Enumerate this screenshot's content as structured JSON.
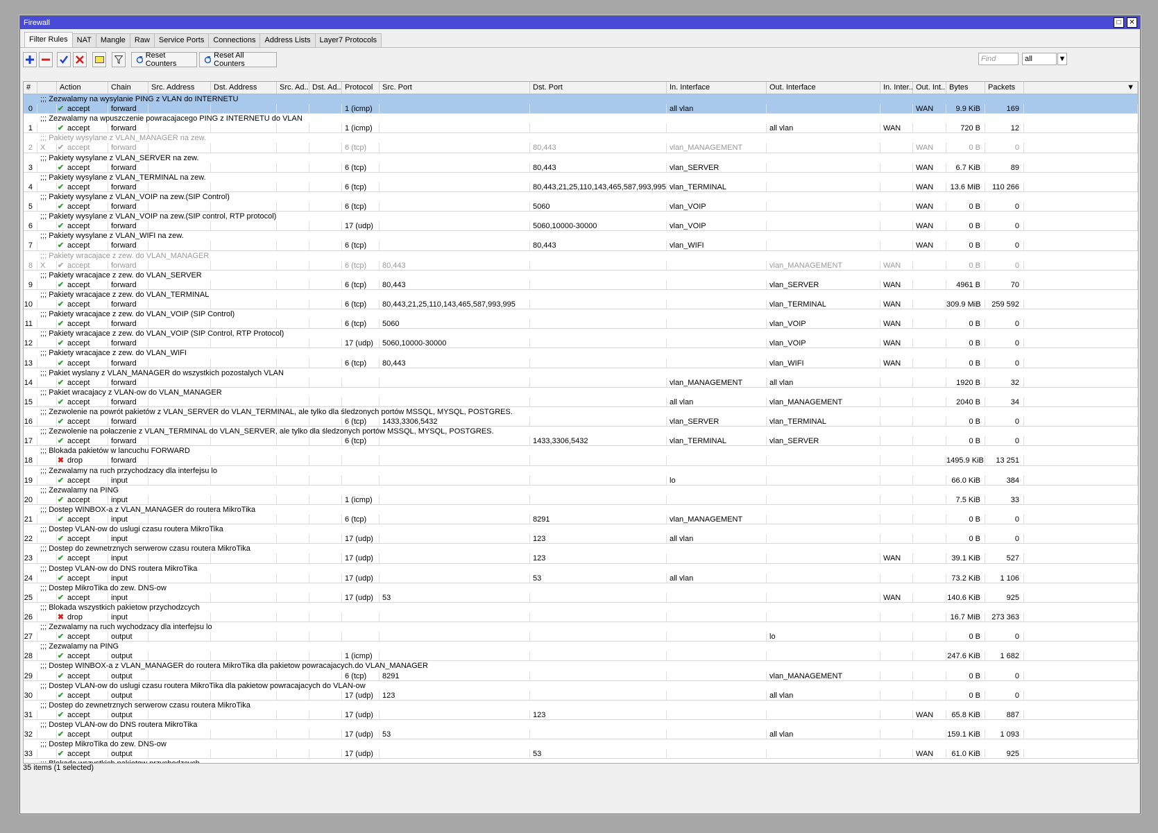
{
  "window": {
    "title": "Firewall"
  },
  "tabs": [
    "Filter Rules",
    "NAT",
    "Mangle",
    "Raw",
    "Service Ports",
    "Connections",
    "Address Lists",
    "Layer7 Protocols"
  ],
  "toolbar": {
    "reset_counters": "Reset Counters",
    "reset_all_counters": "Reset All Counters",
    "find_placeholder": "Find",
    "filter_value": "all"
  },
  "columns": [
    "#",
    "Action",
    "Chain",
    "Src. Address",
    "Dst. Address",
    "Src. Ad...",
    "Dst. Ad...",
    "Protocol",
    "Src. Port",
    "Dst. Port",
    "In. Interface",
    "Out. Interface",
    "In. Inter...",
    "Out. Int...",
    "Bytes",
    "Packets"
  ],
  "status": "35 items (1 selected)",
  "rows": [
    {
      "type": "comment",
      "text": ";;; Zezwalamy na wysylanie PING z VLAN do INTERNETU",
      "selected": true
    },
    {
      "type": "rule",
      "num": "0",
      "x": "",
      "action": "accept",
      "chain": "forward",
      "proto": "1 (icmp)",
      "sport": "",
      "dport": "",
      "inif": "all vlan",
      "outif": "",
      "inlist": "",
      "outlist": "WAN",
      "bytes": "9.9 KiB",
      "packets": "169",
      "selected": true
    },
    {
      "type": "comment",
      "text": ";;; Zezwalamy na wpuszczenie powracajacego PING z INTERNETU do VLAN"
    },
    {
      "type": "rule",
      "num": "1",
      "x": "",
      "action": "accept",
      "chain": "forward",
      "proto": "1 (icmp)",
      "sport": "",
      "dport": "",
      "inif": "",
      "outif": "all vlan",
      "inlist": "WAN",
      "outlist": "",
      "bytes": "720 B",
      "packets": "12"
    },
    {
      "type": "comment",
      "text": ";;; Pakiety wysylane z VLAN_MANAGER na zew.",
      "disabled": true
    },
    {
      "type": "rule",
      "num": "2",
      "x": "X",
      "action": "accept",
      "chain": "forward",
      "proto": "6 (tcp)",
      "sport": "",
      "dport": "80,443",
      "inif": "vlan_MANAGEMENT",
      "outif": "",
      "inlist": "",
      "outlist": "WAN",
      "bytes": "0 B",
      "packets": "0",
      "disabled": true
    },
    {
      "type": "comment",
      "text": ";;; Pakiety wysylane z VLAN_SERVER na zew."
    },
    {
      "type": "rule",
      "num": "3",
      "x": "",
      "action": "accept",
      "chain": "forward",
      "proto": "6 (tcp)",
      "sport": "",
      "dport": "80,443",
      "inif": "vlan_SERVER",
      "outif": "",
      "inlist": "",
      "outlist": "WAN",
      "bytes": "6.7 KiB",
      "packets": "89"
    },
    {
      "type": "comment",
      "text": ";;; Pakiety wysylane z VLAN_TERMINAL na zew."
    },
    {
      "type": "rule",
      "num": "4",
      "x": "",
      "action": "accept",
      "chain": "forward",
      "proto": "6 (tcp)",
      "sport": "",
      "dport": "80,443,21,25,110,143,465,587,993,995",
      "inif": "vlan_TERMINAL",
      "outif": "",
      "inlist": "",
      "outlist": "WAN",
      "bytes": "13.6 MiB",
      "packets": "110 266"
    },
    {
      "type": "comment",
      "text": ";;; Pakiety wysylane z VLAN_VOIP na zew.(SIP Control)"
    },
    {
      "type": "rule",
      "num": "5",
      "x": "",
      "action": "accept",
      "chain": "forward",
      "proto": "6 (tcp)",
      "sport": "",
      "dport": "5060",
      "inif": "vlan_VOIP",
      "outif": "",
      "inlist": "",
      "outlist": "WAN",
      "bytes": "0 B",
      "packets": "0"
    },
    {
      "type": "comment",
      "text": ";;; Pakiety wysylane z VLAN_VOIP na zew.(SIP control, RTP protocol)"
    },
    {
      "type": "rule",
      "num": "6",
      "x": "",
      "action": "accept",
      "chain": "forward",
      "proto": "17 (udp)",
      "sport": "",
      "dport": "5060,10000-30000",
      "inif": "vlan_VOIP",
      "outif": "",
      "inlist": "",
      "outlist": "WAN",
      "bytes": "0 B",
      "packets": "0"
    },
    {
      "type": "comment",
      "text": ";;; Pakiety wysylane z VLAN_WIFI na zew."
    },
    {
      "type": "rule",
      "num": "7",
      "x": "",
      "action": "accept",
      "chain": "forward",
      "proto": "6 (tcp)",
      "sport": "",
      "dport": "80,443",
      "inif": "vlan_WIFI",
      "outif": "",
      "inlist": "",
      "outlist": "WAN",
      "bytes": "0 B",
      "packets": "0"
    },
    {
      "type": "comment",
      "text": ";;; Pakiety wracajace z zew. do VLAN_MANAGER",
      "disabled": true
    },
    {
      "type": "rule",
      "num": "8",
      "x": "X",
      "action": "accept",
      "chain": "forward",
      "proto": "6 (tcp)",
      "sport": "80,443",
      "dport": "",
      "inif": "",
      "outif": "vlan_MANAGEMENT",
      "inlist": "WAN",
      "outlist": "",
      "bytes": "0 B",
      "packets": "0",
      "disabled": true
    },
    {
      "type": "comment",
      "text": ";;; Pakiety wracajace z zew. do VLAN_SERVER"
    },
    {
      "type": "rule",
      "num": "9",
      "x": "",
      "action": "accept",
      "chain": "forward",
      "proto": "6 (tcp)",
      "sport": "80,443",
      "dport": "",
      "inif": "",
      "outif": "vlan_SERVER",
      "inlist": "WAN",
      "outlist": "",
      "bytes": "4961 B",
      "packets": "70"
    },
    {
      "type": "comment",
      "text": ";;; Pakiety wracajace z zew. do VLAN_TERMINAL"
    },
    {
      "type": "rule",
      "num": "10",
      "x": "",
      "action": "accept",
      "chain": "forward",
      "proto": "6 (tcp)",
      "sport": "80,443,21,25,110,143,465,587,993,995",
      "dport": "",
      "inif": "",
      "outif": "vlan_TERMINAL",
      "inlist": "WAN",
      "outlist": "",
      "bytes": "309.9 MiB",
      "packets": "259 592"
    },
    {
      "type": "comment",
      "text": ";;; Pakiety wracajace z zew. do VLAN_VOIP (SIP Control)"
    },
    {
      "type": "rule",
      "num": "11",
      "x": "",
      "action": "accept",
      "chain": "forward",
      "proto": "6 (tcp)",
      "sport": "5060",
      "dport": "",
      "inif": "",
      "outif": "vlan_VOIP",
      "inlist": "WAN",
      "outlist": "",
      "bytes": "0 B",
      "packets": "0"
    },
    {
      "type": "comment",
      "text": ";;; Pakiety wracajace z zew. do VLAN_VOIP (SIP Control, RTP Protocol)"
    },
    {
      "type": "rule",
      "num": "12",
      "x": "",
      "action": "accept",
      "chain": "forward",
      "proto": "17 (udp)",
      "sport": "5060,10000-30000",
      "dport": "",
      "inif": "",
      "outif": "vlan_VOIP",
      "inlist": "WAN",
      "outlist": "",
      "bytes": "0 B",
      "packets": "0"
    },
    {
      "type": "comment",
      "text": ";;; Pakiety wracajace z zew. do VLAN_WIFI"
    },
    {
      "type": "rule",
      "num": "13",
      "x": "",
      "action": "accept",
      "chain": "forward",
      "proto": "6 (tcp)",
      "sport": "80,443",
      "dport": "",
      "inif": "",
      "outif": "vlan_WIFI",
      "inlist": "WAN",
      "outlist": "",
      "bytes": "0 B",
      "packets": "0"
    },
    {
      "type": "comment",
      "text": ";;; Pakiet wyslany z VLAN_MANAGER do wszystkich pozostalych VLAN"
    },
    {
      "type": "rule",
      "num": "14",
      "x": "",
      "action": "accept",
      "chain": "forward",
      "proto": "",
      "sport": "",
      "dport": "",
      "inif": "vlan_MANAGEMENT",
      "outif": "all vlan",
      "inlist": "",
      "outlist": "",
      "bytes": "1920 B",
      "packets": "32"
    },
    {
      "type": "comment",
      "text": ";;; Pakiet wracajacy z VLAN-ow do VLAN_MANAGER"
    },
    {
      "type": "rule",
      "num": "15",
      "x": "",
      "action": "accept",
      "chain": "forward",
      "proto": "",
      "sport": "",
      "dport": "",
      "inif": "all vlan",
      "outif": "vlan_MANAGEMENT",
      "inlist": "",
      "outlist": "",
      "bytes": "2040 B",
      "packets": "34"
    },
    {
      "type": "comment",
      "text": ";;; Zezwolenie na powrót pakietów z VLAN_SERVER do VLAN_TERMINAL, ale tylko dla śledzonych portów MSSQL, MYSQL, POSTGRES."
    },
    {
      "type": "rule",
      "num": "16",
      "x": "",
      "action": "accept",
      "chain": "forward",
      "proto": "6 (tcp)",
      "sport": "1433,3306,5432",
      "dport": "",
      "inif": "vlan_SERVER",
      "outif": "vlan_TERMINAL",
      "inlist": "",
      "outlist": "",
      "bytes": "0 B",
      "packets": "0"
    },
    {
      "type": "comment",
      "text": ";;; Zezwolenie na połaczenie z VLAN_TERMINAL do VLAN_SERVER, ale tylko dla śledzonych portów MSSQL, MYSQL, POSTGRES."
    },
    {
      "type": "rule",
      "num": "17",
      "x": "",
      "action": "accept",
      "chain": "forward",
      "proto": "6 (tcp)",
      "sport": "",
      "dport": "1433,3306,5432",
      "inif": "vlan_TERMINAL",
      "outif": "vlan_SERVER",
      "inlist": "",
      "outlist": "",
      "bytes": "0 B",
      "packets": "0"
    },
    {
      "type": "comment",
      "text": ";;; Blokada pakietów w lancuchu FORWARD"
    },
    {
      "type": "rule",
      "num": "18",
      "x": "",
      "action": "drop",
      "chain": "forward",
      "proto": "",
      "sport": "",
      "dport": "",
      "inif": "",
      "outif": "",
      "inlist": "",
      "outlist": "",
      "bytes": "1495.9 KiB",
      "packets": "13 251"
    },
    {
      "type": "comment",
      "text": ";;; Zezwalamy na ruch przychodzacy dla interfejsu lo"
    },
    {
      "type": "rule",
      "num": "19",
      "x": "",
      "action": "accept",
      "chain": "input",
      "proto": "",
      "sport": "",
      "dport": "",
      "inif": "lo",
      "outif": "",
      "inlist": "",
      "outlist": "",
      "bytes": "66.0 KiB",
      "packets": "384"
    },
    {
      "type": "comment",
      "text": ";;; Zezwalamy na PING"
    },
    {
      "type": "rule",
      "num": "20",
      "x": "",
      "action": "accept",
      "chain": "input",
      "proto": "1 (icmp)",
      "sport": "",
      "dport": "",
      "inif": "",
      "outif": "",
      "inlist": "",
      "outlist": "",
      "bytes": "7.5 KiB",
      "packets": "33"
    },
    {
      "type": "comment",
      "text": ";;; Dostep WINBOX-a z VLAN_MANAGER do routera MikroTika"
    },
    {
      "type": "rule",
      "num": "21",
      "x": "",
      "action": "accept",
      "chain": "input",
      "proto": "6 (tcp)",
      "sport": "",
      "dport": "8291",
      "inif": "vlan_MANAGEMENT",
      "outif": "",
      "inlist": "",
      "outlist": "",
      "bytes": "0 B",
      "packets": "0"
    },
    {
      "type": "comment",
      "text": ";;; Dostep VLAN-ow do uslugi czasu routera MikroTika"
    },
    {
      "type": "rule",
      "num": "22",
      "x": "",
      "action": "accept",
      "chain": "input",
      "proto": "17 (udp)",
      "sport": "",
      "dport": "123",
      "inif": "all vlan",
      "outif": "",
      "inlist": "",
      "outlist": "",
      "bytes": "0 B",
      "packets": "0"
    },
    {
      "type": "comment",
      "text": ";;; Dostep do zewnetrznych serwerow czasu routera MikroTika"
    },
    {
      "type": "rule",
      "num": "23",
      "x": "",
      "action": "accept",
      "chain": "input",
      "proto": "17 (udp)",
      "sport": "",
      "dport": "123",
      "inif": "",
      "outif": "",
      "inlist": "WAN",
      "outlist": "",
      "bytes": "39.1 KiB",
      "packets": "527"
    },
    {
      "type": "comment",
      "text": ";;; Dostep VLAN-ow do DNS routera MikroTika"
    },
    {
      "type": "rule",
      "num": "24",
      "x": "",
      "action": "accept",
      "chain": "input",
      "proto": "17 (udp)",
      "sport": "",
      "dport": "53",
      "inif": "all vlan",
      "outif": "",
      "inlist": "",
      "outlist": "",
      "bytes": "73.2 KiB",
      "packets": "1 106"
    },
    {
      "type": "comment",
      "text": ";;; Dostep MikroTika do zew. DNS-ow"
    },
    {
      "type": "rule",
      "num": "25",
      "x": "",
      "action": "accept",
      "chain": "input",
      "proto": "17 (udp)",
      "sport": "53",
      "dport": "",
      "inif": "",
      "outif": "",
      "inlist": "WAN",
      "outlist": "",
      "bytes": "140.6 KiB",
      "packets": "925"
    },
    {
      "type": "comment",
      "text": ";;; Blokada wszystkich pakietow przychodzcych"
    },
    {
      "type": "rule",
      "num": "26",
      "x": "",
      "action": "drop",
      "chain": "input",
      "proto": "",
      "sport": "",
      "dport": "",
      "inif": "",
      "outif": "",
      "inlist": "",
      "outlist": "",
      "bytes": "16.7 MiB",
      "packets": "273 363"
    },
    {
      "type": "comment",
      "text": ";;; Zezwalamy na ruch wychodzacy dla interfejsu lo"
    },
    {
      "type": "rule",
      "num": "27",
      "x": "",
      "action": "accept",
      "chain": "output",
      "proto": "",
      "sport": "",
      "dport": "",
      "inif": "",
      "outif": "lo",
      "inlist": "",
      "outlist": "",
      "bytes": "0 B",
      "packets": "0"
    },
    {
      "type": "comment",
      "text": ";;; Zezwalamy na PING"
    },
    {
      "type": "rule",
      "num": "28",
      "x": "",
      "action": "accept",
      "chain": "output",
      "proto": "1 (icmp)",
      "sport": "",
      "dport": "",
      "inif": "",
      "outif": "",
      "inlist": "",
      "outlist": "",
      "bytes": "247.6 KiB",
      "packets": "1 682"
    },
    {
      "type": "comment",
      "text": ";;; Dostep WINBOX-a z VLAN_MANAGER do routera MikroTika dla pakietow powracajacych.do VLAN_MANAGER"
    },
    {
      "type": "rule",
      "num": "29",
      "x": "",
      "action": "accept",
      "chain": "output",
      "proto": "6 (tcp)",
      "sport": "8291",
      "dport": "",
      "inif": "",
      "outif": "vlan_MANAGEMENT",
      "inlist": "",
      "outlist": "",
      "bytes": "0 B",
      "packets": "0"
    },
    {
      "type": "comment",
      "text": ";;; Dostep VLAN-ow do uslugi czasu routera MikroTika dla pakietow powracajacych do VLAN-ow"
    },
    {
      "type": "rule",
      "num": "30",
      "x": "",
      "action": "accept",
      "chain": "output",
      "proto": "17 (udp)",
      "sport": "123",
      "dport": "",
      "inif": "",
      "outif": "all vlan",
      "inlist": "",
      "outlist": "",
      "bytes": "0 B",
      "packets": "0"
    },
    {
      "type": "comment",
      "text": ";;; Dostep do zewnetrznych serwerow czasu routera MikroTika"
    },
    {
      "type": "rule",
      "num": "31",
      "x": "",
      "action": "accept",
      "chain": "output",
      "proto": "17 (udp)",
      "sport": "",
      "dport": "123",
      "inif": "",
      "outif": "",
      "inlist": "",
      "outlist": "WAN",
      "bytes": "65.8 KiB",
      "packets": "887"
    },
    {
      "type": "comment",
      "text": ";;; Dostep VLAN-ow do DNS routera MikroTika"
    },
    {
      "type": "rule",
      "num": "32",
      "x": "",
      "action": "accept",
      "chain": "output",
      "proto": "17 (udp)",
      "sport": "53",
      "dport": "",
      "inif": "",
      "outif": "all vlan",
      "inlist": "",
      "outlist": "",
      "bytes": "159.1 KiB",
      "packets": "1 093"
    },
    {
      "type": "comment",
      "text": ";;; Dostep MikroTika do zew. DNS-ow"
    },
    {
      "type": "rule",
      "num": "33",
      "x": "",
      "action": "accept",
      "chain": "output",
      "proto": "17 (udp)",
      "sport": "",
      "dport": "53",
      "inif": "",
      "outif": "",
      "inlist": "",
      "outlist": "WAN",
      "bytes": "61.0 KiB",
      "packets": "925"
    },
    {
      "type": "comment",
      "text": ";;; Blokada wszystkich pakietow przychodzcych"
    }
  ]
}
